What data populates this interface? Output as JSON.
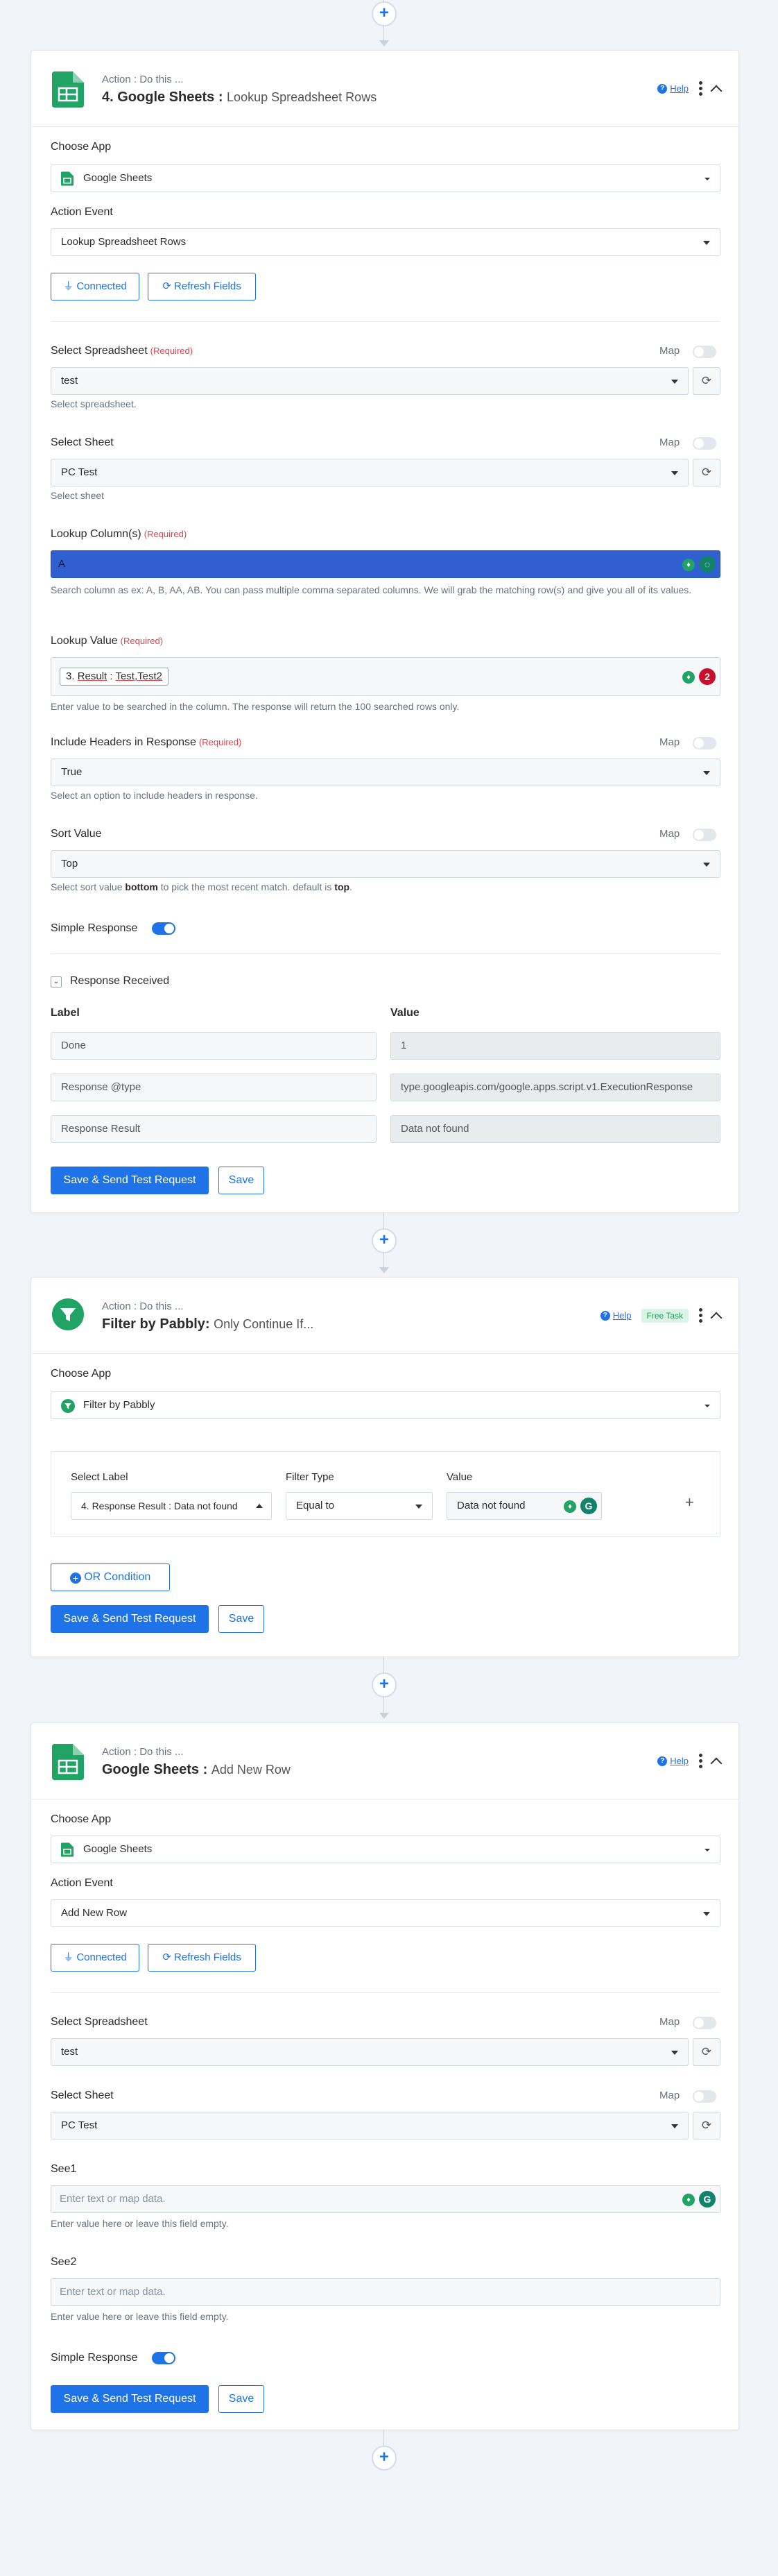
{
  "step4": {
    "action_sub": "Action : Do this ...",
    "title_bold": "4. Google Sheets :",
    "title_light": "Lookup Spreadsheet Rows",
    "help": "Help",
    "choose_app_label": "Choose App",
    "choose_app_value": "Google Sheets",
    "action_event_label": "Action Event",
    "action_event_value": "Lookup Spreadsheet Rows",
    "connected_label": "Connected",
    "refresh_fields_label": "Refresh Fields",
    "select_spreadsheet_label": "Select Spreadsheet",
    "required": "(Required)",
    "map_label": "Map",
    "spreadsheet_value": "test",
    "spreadsheet_hint": "Select spreadsheet.",
    "select_sheet_label": "Select Sheet",
    "sheet_value": "PC Test",
    "sheet_hint": "Select sheet",
    "lookup_column_label": "Lookup Column(s)",
    "lookup_column_value": "A",
    "lookup_column_hint": "Search column as ex: A, B, AA, AB. You can pass multiple comma separated columns. We will grab the matching row(s) and give you all of its values.",
    "lookup_value_label": "Lookup Value",
    "lookup_value_chip_prefix": "3. ",
    "lookup_value_chip_mid": "Result",
    "lookup_value_chip_rest": " : ",
    "lookup_value_chip_end": "Test,Test2",
    "lookup_value_count": "2",
    "lookup_value_hint": "Enter value to be searched in the column. The response will return the 100 searched rows only.",
    "include_headers_label": "Include Headers in Response",
    "include_headers_value": "True",
    "include_headers_hint": "Select an option to include headers in response.",
    "sort_value_label": "Sort Value",
    "sort_value_value": "Top",
    "sort_hint_a": "Select sort value ",
    "sort_hint_b": "bottom",
    "sort_hint_c": " to pick the most recent match. default is ",
    "sort_hint_d": "top",
    "sort_hint_e": ".",
    "simple_response_label": "Simple Response",
    "response_received_label": "Response Received",
    "col_label": "Label",
    "col_value": "Value",
    "responses": [
      {
        "label": "Done",
        "value": "1"
      },
      {
        "label": "Response @type",
        "value": "type.googleapis.com/google.apps.script.v1.ExecutionResponse"
      },
      {
        "label": "Response Result",
        "value": "Data not found"
      }
    ],
    "save_send_label": "Save & Send Test Request",
    "save_label": "Save"
  },
  "filter": {
    "action_sub": "Action : Do this ...",
    "title_bold": "Filter by Pabbly:",
    "title_light": "Only Continue If...",
    "help": "Help",
    "free_task": "Free Task",
    "choose_app_label": "Choose App",
    "choose_app_value": "Filter by Pabbly",
    "select_label_head": "Select Label",
    "filter_type_head": "Filter Type",
    "value_head": "Value",
    "select_label_value": "4. Response Result : Data not found",
    "filter_type_value": "Equal to",
    "value_value": "Data not found",
    "or_condition_label": "OR Condition",
    "save_send_label": "Save & Send Test Request",
    "save_label": "Save"
  },
  "step6": {
    "action_sub": "Action : Do this ...",
    "title_bold": "Google Sheets :",
    "title_light": "Add New Row",
    "help": "Help",
    "choose_app_label": "Choose App",
    "choose_app_value": "Google Sheets",
    "action_event_label": "Action Event",
    "action_event_value": "Add New Row",
    "connected_label": "Connected",
    "refresh_fields_label": "Refresh Fields",
    "select_spreadsheet_label": "Select Spreadsheet",
    "map_label": "Map",
    "spreadsheet_value": "test",
    "select_sheet_label": "Select Sheet",
    "sheet_value": "PC Test",
    "see1_label": "See1",
    "see1_placeholder": "Enter text or map data.",
    "see1_hint": "Enter value here or leave this field empty.",
    "see2_label": "See2",
    "see2_placeholder": "Enter text or map data.",
    "see2_hint": "Enter value here or leave this field empty.",
    "simple_response_label": "Simple Response",
    "save_send_label": "Save & Send Test Request",
    "save_label": "Save"
  },
  "colors": {
    "accent": "#1e73e8",
    "sheets_green": "#21a366",
    "required_red": "#e5424d",
    "free_task_bg": "#d8f5e5"
  },
  "icons": [
    "plus-icon",
    "google-sheets-icon",
    "filter-icon",
    "help-icon",
    "kebab-icon",
    "chevron-up-icon",
    "caret-down-icon",
    "refresh-icon",
    "plug-icon",
    "chevron-down-icon",
    "grammarly-icon"
  ]
}
